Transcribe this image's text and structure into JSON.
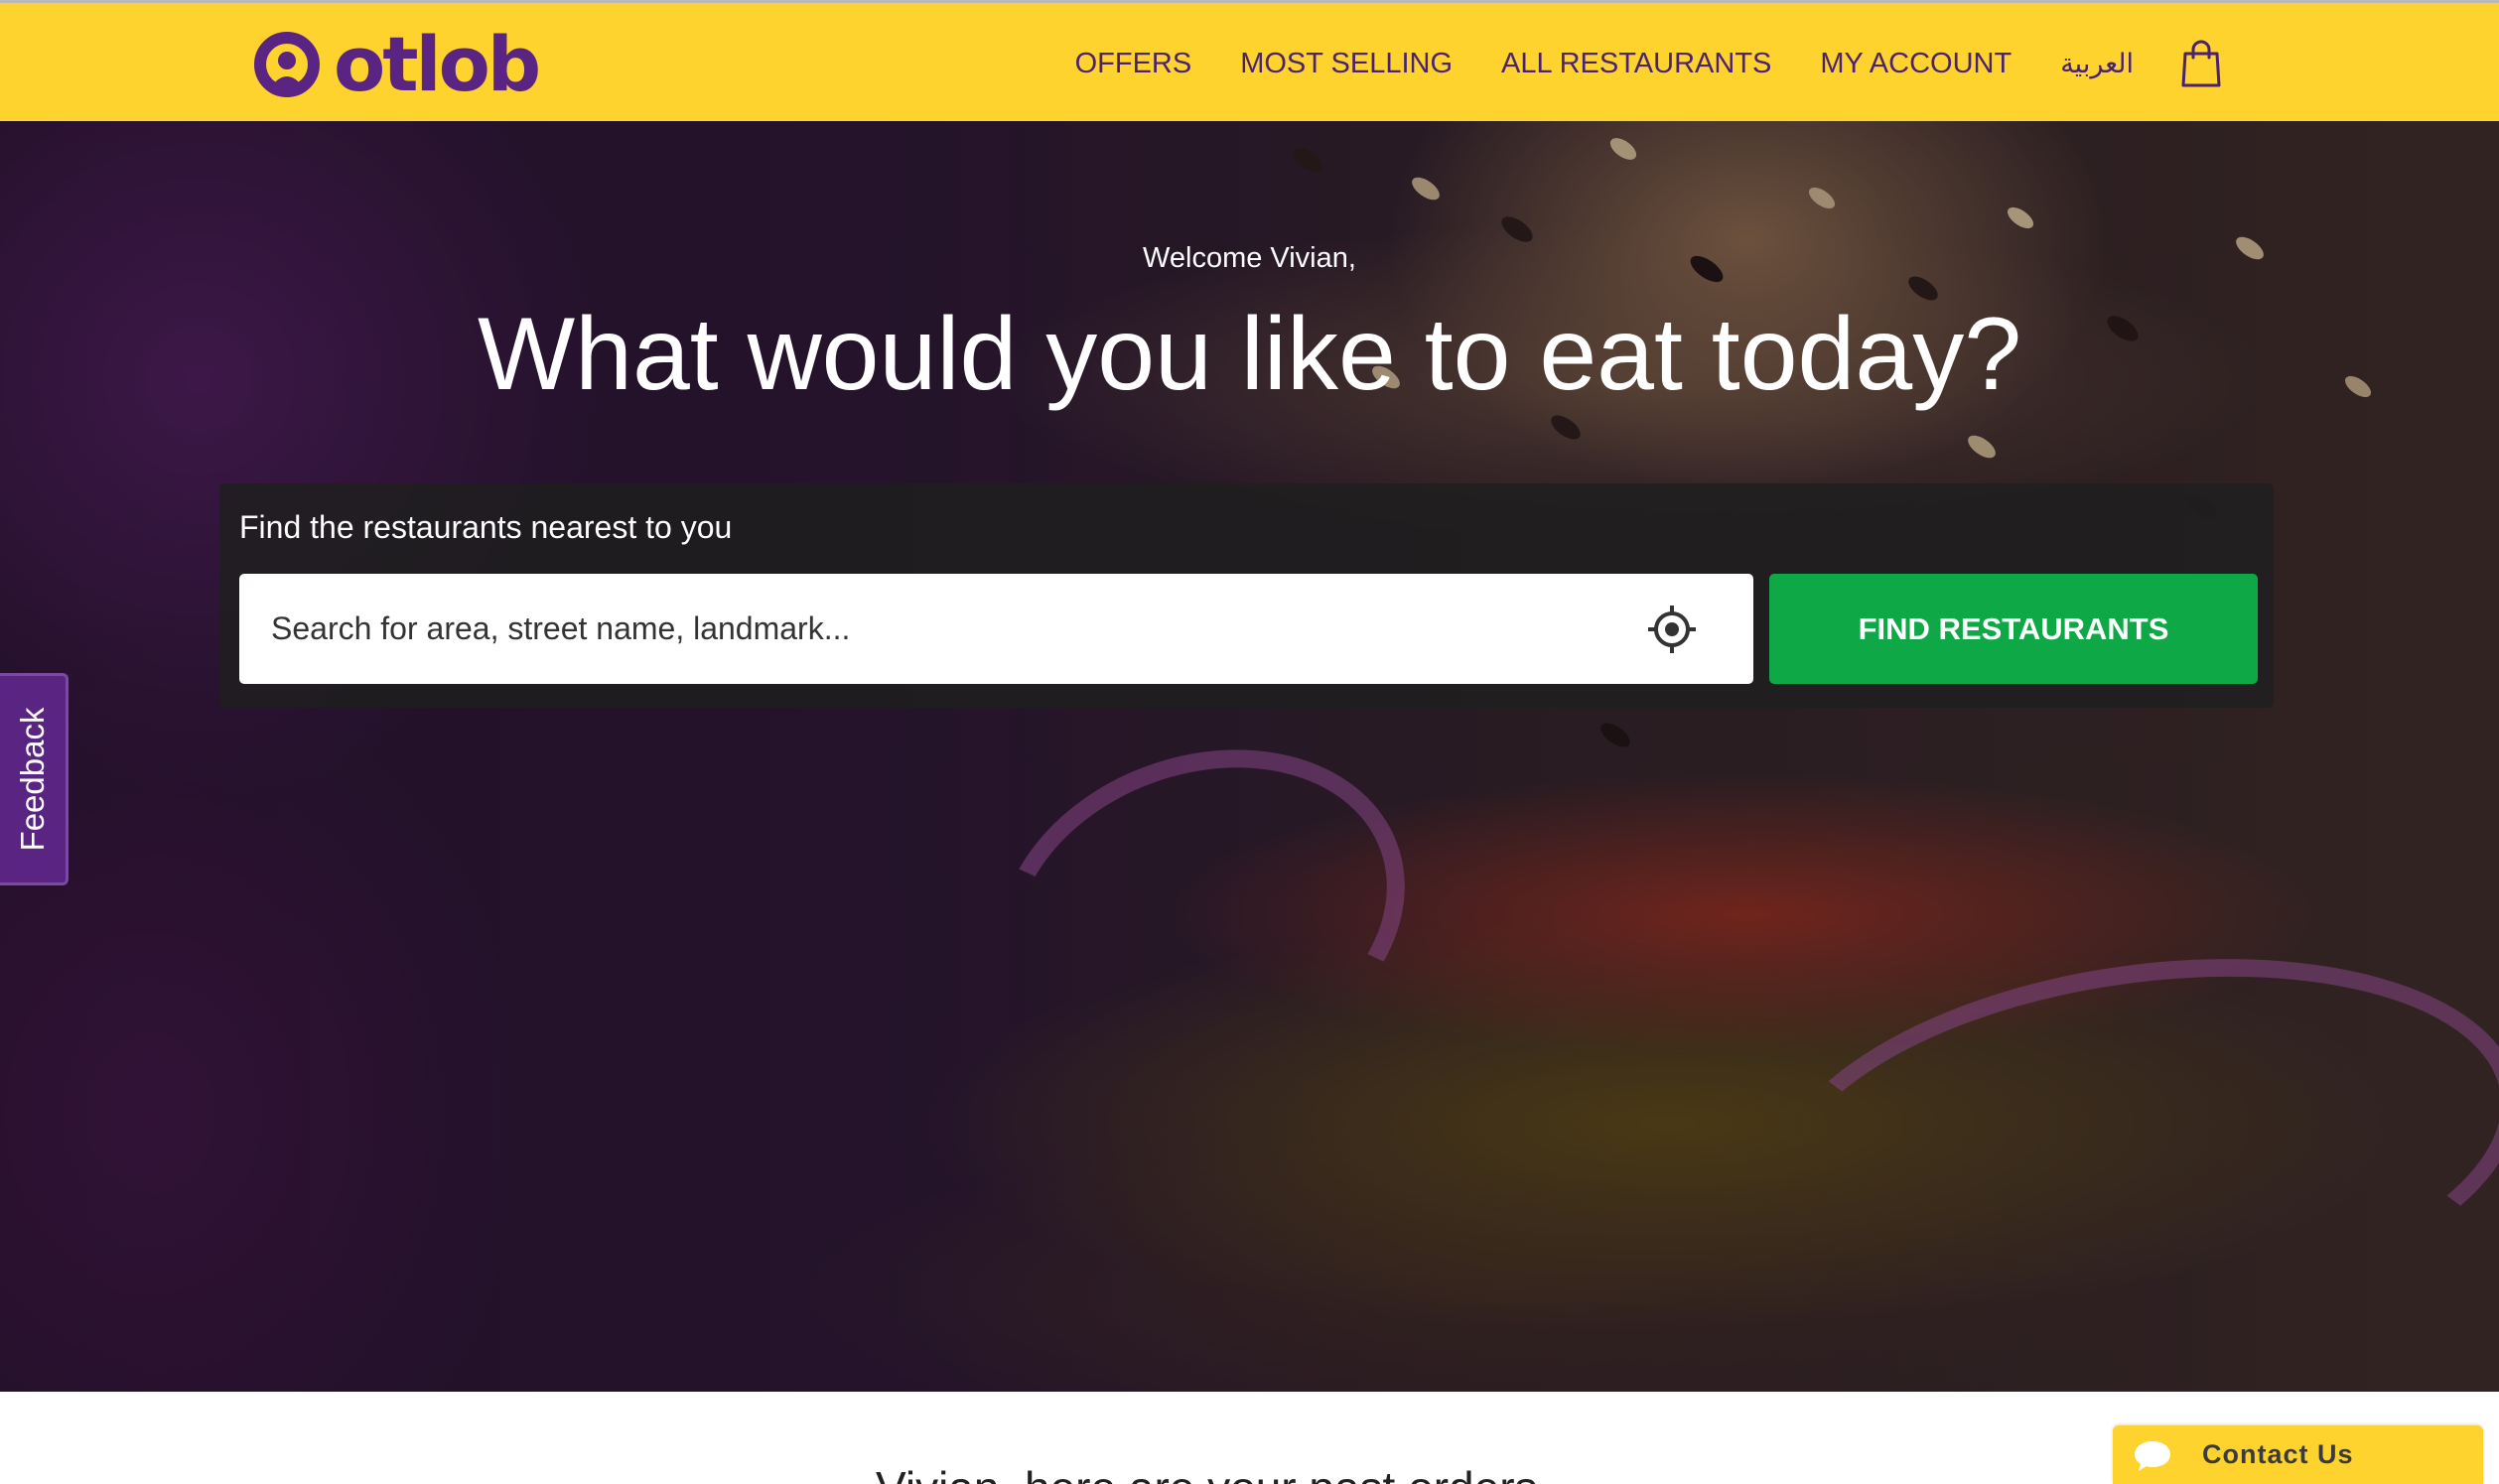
{
  "brand": {
    "name": "otlob",
    "primary_color": "#5a2483",
    "accent_color": "#ffd32e",
    "cta_color": "#0fa847"
  },
  "nav": {
    "items": [
      {
        "label": "OFFERS"
      },
      {
        "label": "MOST SELLING"
      },
      {
        "label": "ALL RESTAURANTS"
      },
      {
        "label": "MY ACCOUNT"
      },
      {
        "label": "العربية"
      }
    ],
    "cart_icon": "shopping-bag-icon"
  },
  "hero": {
    "welcome": "Welcome Vivian,",
    "headline": "What would you like to eat today?",
    "search": {
      "caption": "Find the restaurants nearest to you",
      "placeholder": "Search for area, street name, landmark...",
      "value": "",
      "locate_icon": "locate-crosshair-icon",
      "button_label": "FIND RESTAURANTS"
    }
  },
  "feedback": {
    "label": "Feedback"
  },
  "contact": {
    "label": "Contact Us",
    "icon": "chat-bubble-icon"
  },
  "section": {
    "heading": "Vivian, here are your past orders"
  }
}
